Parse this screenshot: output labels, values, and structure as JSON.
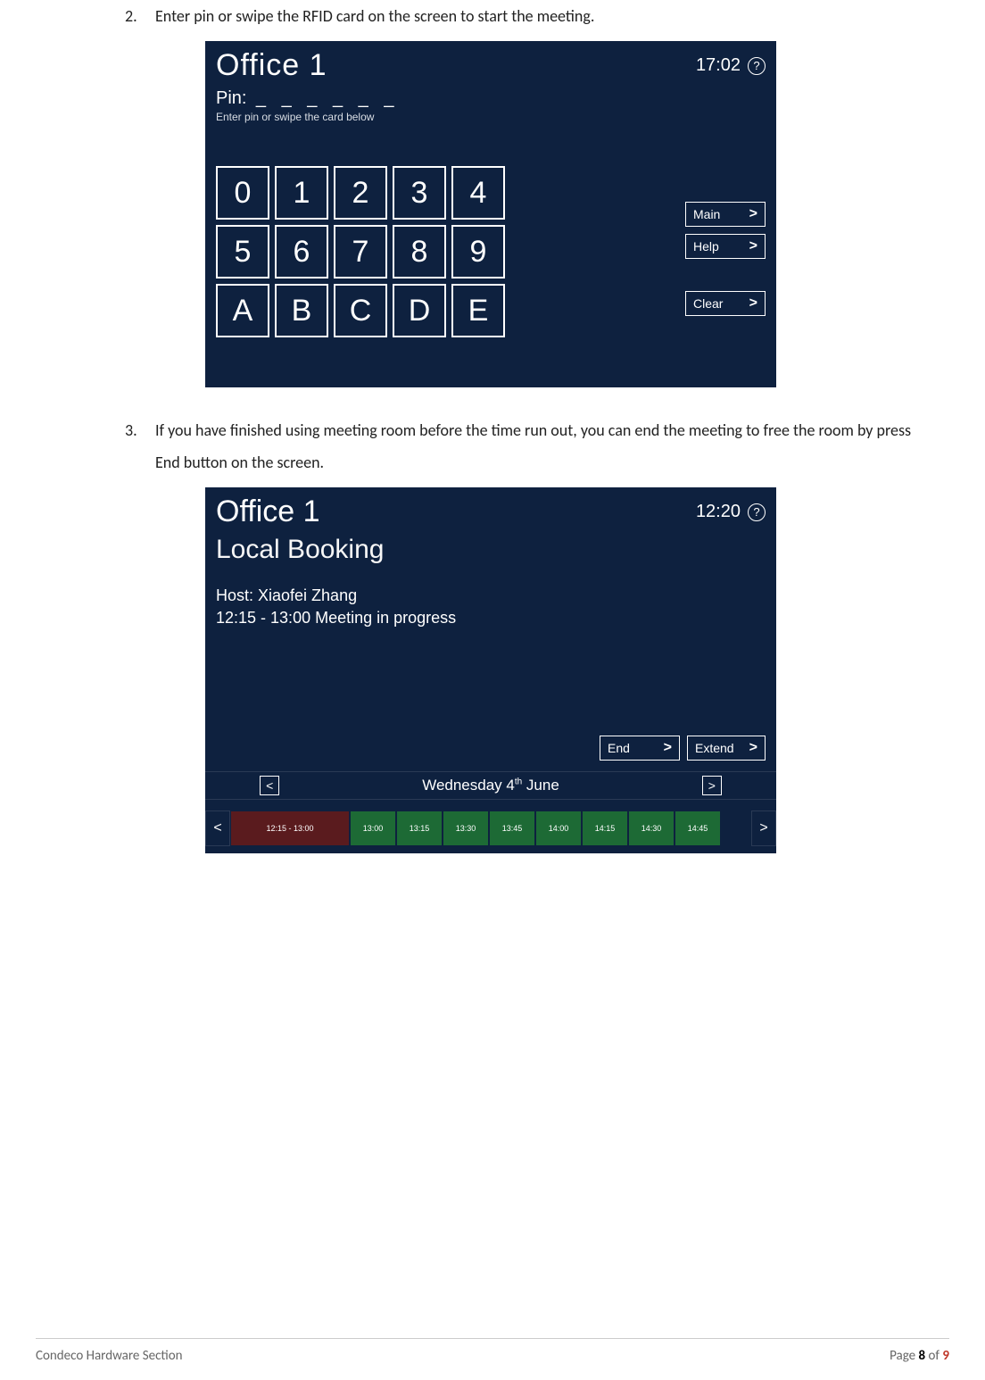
{
  "steps": {
    "s2": {
      "num": "2.",
      "text": "Enter pin or swipe the RFID card on the screen to start the meeting."
    },
    "s3": {
      "num": "3.",
      "text": "If you have finished using meeting room before the time run out, you can end the meeting to free the room by press End button on the screen."
    }
  },
  "pin_screen": {
    "title": "Office 1",
    "clock": "17:02",
    "help_glyph": "?",
    "pin_label": "Pin:",
    "pin_dashes": "_ _ _ _ _ _",
    "pin_sub": "Enter pin or swipe the card below",
    "keys": [
      "0",
      "1",
      "2",
      "3",
      "4",
      "5",
      "6",
      "7",
      "8",
      "9",
      "A",
      "B",
      "C",
      "D",
      "E"
    ],
    "side": {
      "main": "Main",
      "help": "Help",
      "clear": "Clear"
    },
    "chev": ">"
  },
  "book_screen": {
    "title": "Office 1",
    "clock": "12:20",
    "help_glyph": "?",
    "heading": "Local Booking",
    "host": "Host: Xiaofei Zhang",
    "status": "12:15 - 13:00 Meeting in progress",
    "actions": {
      "end": "End",
      "extend": "Extend"
    },
    "chev": ">",
    "date_prev": "<",
    "date_next": ">",
    "date_label_pre": "Wednesday 4",
    "date_label_sup": "th",
    "date_label_post": " June",
    "timeline": {
      "prev": "<",
      "next": ">",
      "busy": "12:15 - 13:00",
      "free": [
        "13:00",
        "13:15",
        "13:30",
        "13:45",
        "14:00",
        "14:15",
        "14:30",
        "14:45"
      ]
    }
  },
  "footer": {
    "left": "Condeco Hardware Section",
    "page_prefix": "Page ",
    "page_cur": "8",
    "page_of": " of ",
    "page_total": "9"
  }
}
